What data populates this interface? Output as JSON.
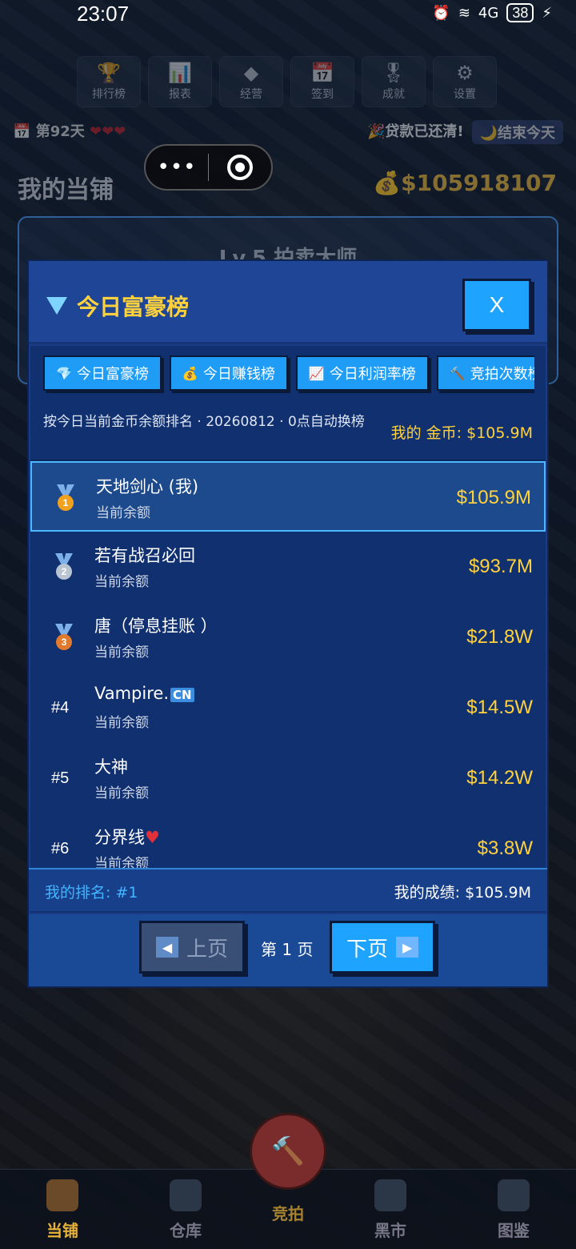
{
  "status": {
    "time": "23:07",
    "network": "4G",
    "battery": "38"
  },
  "topnav": [
    {
      "icon": "trophy-icon",
      "glyph": "🏆",
      "label": "排行榜"
    },
    {
      "icon": "chart-icon",
      "glyph": "📊",
      "label": "报表"
    },
    {
      "icon": "diamond-icon",
      "glyph": "◆",
      "label": "经营"
    },
    {
      "icon": "calendar-icon",
      "glyph": "📅",
      "label": "签到"
    },
    {
      "icon": "medal-icon",
      "glyph": "🎖",
      "label": "成就"
    },
    {
      "icon": "gear-icon",
      "glyph": "⚙",
      "label": "设置"
    }
  ],
  "dayrow": {
    "day": "第92天",
    "hearts": "❤❤❤",
    "loan": "贷款已还清!",
    "end_day": "结束今天"
  },
  "shop": {
    "title": "我的当铺",
    "money": "$105918107",
    "level": "Lv.5 拍卖大师"
  },
  "modal": {
    "title": "今日富豪榜",
    "close": "X",
    "tabs": [
      {
        "icon": "💎",
        "label": "今日富豪榜"
      },
      {
        "icon": "💰",
        "label": "今日赚钱榜"
      },
      {
        "icon": "📈",
        "label": "今日利润率榜"
      },
      {
        "icon": "🔨",
        "label": "竞拍次数榜"
      }
    ],
    "description": "按今日当前金币余额排名 · 20260812 · 0点自动换榜",
    "my_coins": "我的 金币: $105.9M",
    "rows": [
      {
        "rank": "1",
        "name": "天地剑心 (我)",
        "sub": "当前余额",
        "value": "$105.9M"
      },
      {
        "rank": "2",
        "name": "若有战召必回",
        "sub": "当前余额",
        "value": "$93.7M"
      },
      {
        "rank": "3",
        "name": "唐（停息挂账  ）",
        "sub": "当前余额",
        "value": "$21.8W"
      },
      {
        "rank": "#4",
        "name": "Vampire.",
        "flag": "CN",
        "sub": "当前余额",
        "value": "$14.5W"
      },
      {
        "rank": "#5",
        "name": "大神",
        "sub": "当前余额",
        "value": "$14.2W"
      },
      {
        "rank": "#6",
        "name": "分界线",
        "heart": "♥",
        "sub": "当前余额",
        "value": "$3.8W"
      }
    ],
    "my_rank": "我的排名: #1",
    "my_score": "我的成绩: $105.9M",
    "pager": {
      "prev": "上页",
      "page": "第 1 页",
      "next": "下页",
      "prev_arrow": "◀",
      "next_arrow": "▶"
    }
  },
  "bottomnav": {
    "shop": "当铺",
    "warehouse": "仓库",
    "auction": "竞拍",
    "blackmarket": "黑市",
    "catalog": "图鉴"
  }
}
